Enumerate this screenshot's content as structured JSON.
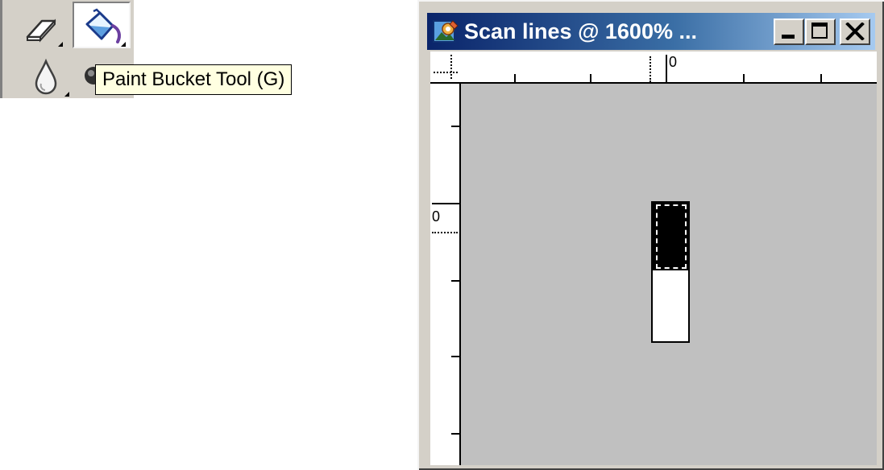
{
  "toolbox": {
    "tools": [
      {
        "name": "eraser-tool",
        "icon": "eraser-icon",
        "active": false
      },
      {
        "name": "paint-bucket-tool",
        "icon": "paint-bucket-icon",
        "active": true
      },
      {
        "name": "blur-tool",
        "icon": "water-drop-icon",
        "active": false
      },
      {
        "name": "dodge-tool",
        "icon": "dodge-icon",
        "active": false
      }
    ],
    "tooltip": "Paint Bucket Tool (G)"
  },
  "document_window": {
    "title": "Scan lines @ 1600% ...",
    "icon": "photoshop-document-icon",
    "controls": {
      "minimize": "minimize-icon",
      "maximize": "maximize-icon",
      "close": "close-icon"
    },
    "ruler_horizontal_origin": "0",
    "ruler_vertical_origin": "0",
    "canvas": {
      "background_color": "#c0c0c0",
      "pixels": [
        {
          "fill": "#000000",
          "selected": true
        },
        {
          "fill": "#ffffff",
          "selected": false
        }
      ]
    }
  },
  "colors": {
    "titlebar_start": "#0a246a",
    "titlebar_end": "#a6caf0",
    "tooltip_bg": "#ffffe1",
    "chrome": "#d4d0c8"
  }
}
